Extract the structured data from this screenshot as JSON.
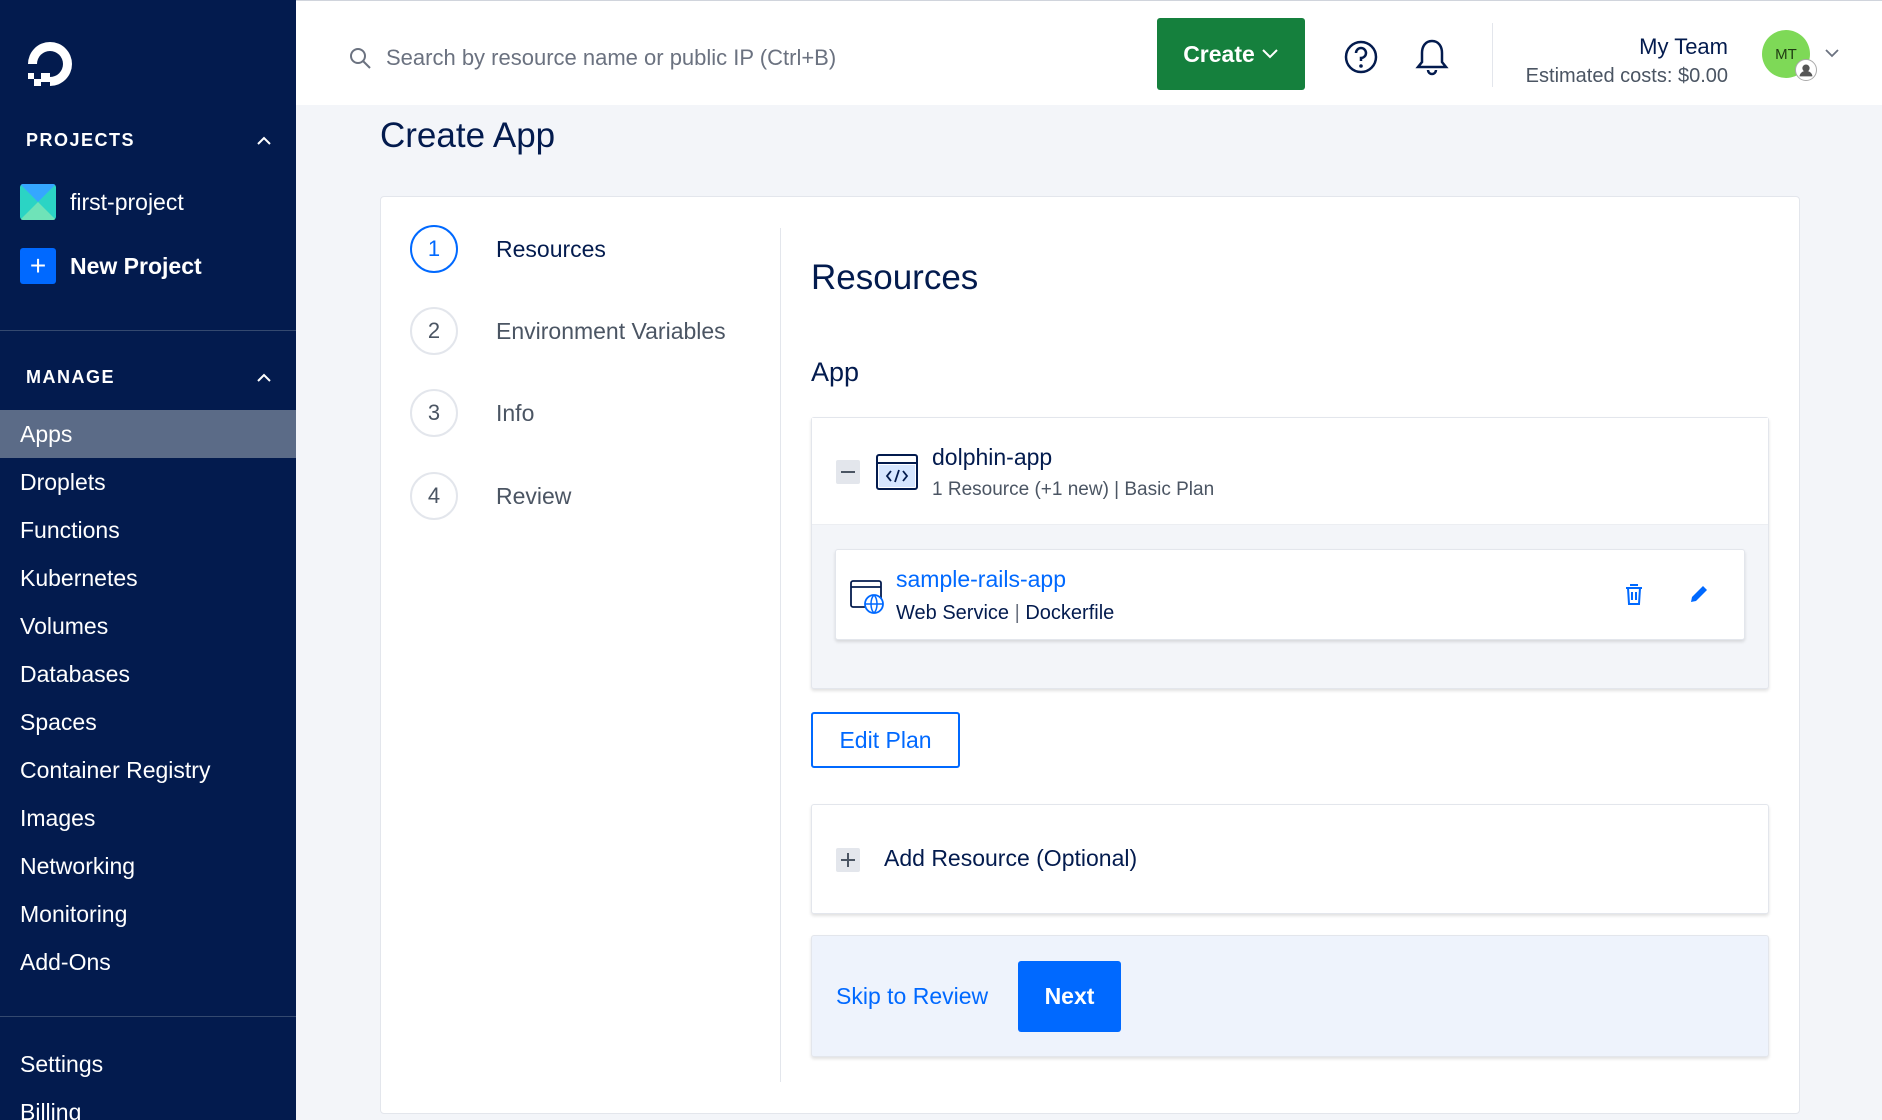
{
  "sidebar": {
    "projects_heading": "PROJECTS",
    "projects": [
      {
        "label": "first-project"
      },
      {
        "label": "New Project"
      }
    ],
    "manage_heading": "MANAGE",
    "items": [
      {
        "label": "Apps",
        "active": true
      },
      {
        "label": "Droplets"
      },
      {
        "label": "Functions"
      },
      {
        "label": "Kubernetes"
      },
      {
        "label": "Volumes"
      },
      {
        "label": "Databases"
      },
      {
        "label": "Spaces"
      },
      {
        "label": "Container Registry"
      },
      {
        "label": "Images"
      },
      {
        "label": "Networking"
      },
      {
        "label": "Monitoring"
      },
      {
        "label": "Add-Ons"
      }
    ],
    "bottom_items": [
      {
        "label": "Settings"
      },
      {
        "label": "Billing"
      }
    ]
  },
  "topbar": {
    "search_placeholder": "Search by resource name or public IP (Ctrl+B)",
    "create_label": "Create",
    "team_name": "My Team",
    "estimated_costs": "Estimated costs: $0.00",
    "avatar_initials": "MT"
  },
  "page": {
    "title": "Create App"
  },
  "steps": [
    {
      "number": "1",
      "label": "Resources",
      "active": true
    },
    {
      "number": "2",
      "label": "Environment Variables"
    },
    {
      "number": "3",
      "label": "Info"
    },
    {
      "number": "4",
      "label": "Review"
    }
  ],
  "resources": {
    "title": "Resources",
    "section_label": "App",
    "app": {
      "name": "dolphin-app",
      "meta": "1 Resource (+1 new) | Basic Plan"
    },
    "service": {
      "name": "sample-rails-app",
      "type": "Web Service",
      "source": "Dockerfile"
    },
    "edit_plan_label": "Edit Plan",
    "add_resource_label": "Add Resource (Optional)",
    "skip_label": "Skip to Review",
    "next_label": "Next"
  },
  "colors": {
    "sidebar_bg": "#031b4e",
    "primary": "#0069ff",
    "create_green": "#15803d",
    "active_nav": "#5b6b87"
  }
}
